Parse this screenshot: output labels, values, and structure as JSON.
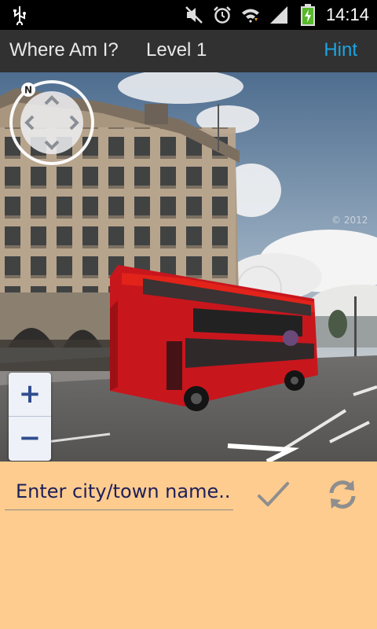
{
  "status_bar": {
    "time": "14:14",
    "icons": [
      "usb-icon",
      "mute-icon",
      "alarm-icon",
      "wifi-icon",
      "signal-icon",
      "battery-charging-icon"
    ]
  },
  "action_bar": {
    "title": "Where Am I?",
    "level": "Level 1",
    "hint": "Hint"
  },
  "street_view": {
    "watermark": "© 2012",
    "compass_label": "N",
    "zoom_in": "+",
    "zoom_out": "−"
  },
  "answer": {
    "placeholder": "Enter city/town name..",
    "value": ""
  },
  "colors": {
    "action_bar": "#313131",
    "hint_accent": "#1ba5e2",
    "panel_background": "#ffcc8f",
    "bus_red": "#c8161d"
  }
}
